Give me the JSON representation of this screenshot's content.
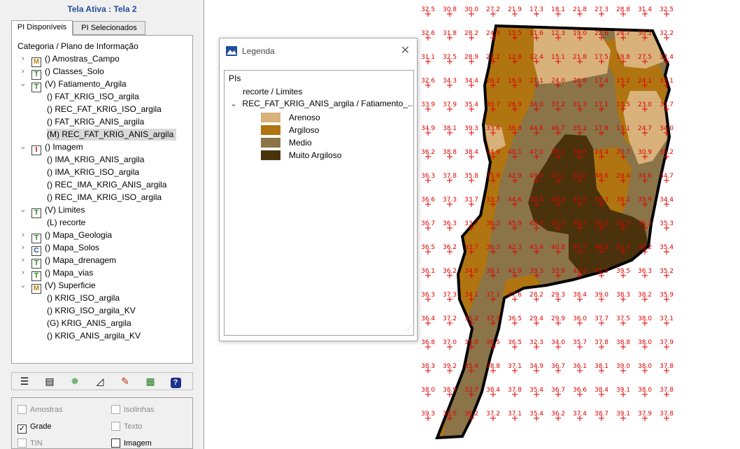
{
  "left_panel": {
    "title": "Tela Ativa : Tela 2",
    "tabs": [
      "PI Disponíveis",
      "PI Selecionados"
    ],
    "tree_header": "Categoria / Plano de Informação",
    "tree": [
      {
        "label": "() Amostras_Campo",
        "icon": "M",
        "expanded": false
      },
      {
        "label": "() Classes_Solo",
        "icon": "T",
        "expanded": false
      },
      {
        "label": "(V) Fatiamento_Argila",
        "icon": "T",
        "expanded": true
      },
      {
        "label": "() FAT_KRIG_ISO_argila",
        "child": true
      },
      {
        "label": "() REC_FAT_KRIG_ISO_argila",
        "child": true
      },
      {
        "label": "() FAT_KRIG_ANIS_argila",
        "child": true
      },
      {
        "label": "(M) REC_FAT_KRIG_ANIS_argila",
        "child": true,
        "selected": true
      },
      {
        "label": "() Imagem",
        "icon": "I",
        "expanded": true
      },
      {
        "label": "() IMA_KRIG_ANIS_argila",
        "child": true
      },
      {
        "label": "() IMA_KRIG_ISO_argila",
        "child": true
      },
      {
        "label": "() REC_IMA_KRIG_ANIS_argila",
        "child": true
      },
      {
        "label": "() REC_IMA_KRIG_ISO_argila",
        "child": true
      },
      {
        "label": "(V) Limites",
        "icon": "T",
        "expanded": true
      },
      {
        "label": "(L) recorte",
        "child": true
      },
      {
        "label": "() Mapa_Geologia",
        "icon": "T",
        "expanded": false
      },
      {
        "label": "() Mapa_Solos",
        "icon": "C",
        "expanded": false
      },
      {
        "label": "() Mapa_drenagem",
        "icon": "T",
        "expanded": false
      },
      {
        "label": "() Mapa_vias",
        "icon": "T",
        "expanded": false
      },
      {
        "label": "(V) Superficie",
        "icon": "M",
        "expanded": true
      },
      {
        "label": "() KRIG_ISO_argila",
        "child": true
      },
      {
        "label": "() KRIG_ISO_argila_KV",
        "child": true
      },
      {
        "label": "(G) KRIG_ANIS_argila",
        "child": true
      },
      {
        "label": "() KRIG_ANIS_argila_KV",
        "child": true
      }
    ],
    "toolbar_icons": [
      "list-icon",
      "properties-icon",
      "tools-icon",
      "chart-icon",
      "pencil-icon",
      "table-icon",
      "help-icon"
    ],
    "options": [
      {
        "label": "Amostras",
        "checked": false,
        "enabled": false
      },
      {
        "label": "Isolinhas",
        "checked": false,
        "enabled": false
      },
      {
        "label": "Grade",
        "checked": true,
        "enabled": true
      },
      {
        "label": "Texto",
        "checked": false,
        "enabled": false
      },
      {
        "label": "TIN",
        "checked": false,
        "enabled": false
      },
      {
        "label": "Imagem",
        "checked": false,
        "enabled": true
      }
    ]
  },
  "legend": {
    "title": "Legenda",
    "root_label": "PIs",
    "items": [
      "recorte / Limites",
      "REC_FAT_KRIG_ANIS_argila / Fatiamento_..."
    ],
    "classes": [
      {
        "label": "Arenoso",
        "color": "#d8b27a"
      },
      {
        "label": "Argiloso",
        "color": "#b07510"
      },
      {
        "label": "Medio",
        "color": "#8a7448"
      },
      {
        "label": "Muito Argiloso",
        "color": "#4a330c"
      }
    ]
  },
  "map": {
    "grid_values": [
      [
        "32.5",
        "30.8",
        "30.0",
        "27.2",
        "21.9",
        "17.3",
        "18.1",
        "21.8",
        "27.3",
        "28.8",
        "31.4",
        "32.5"
      ],
      [
        "32.6",
        "31.8",
        "28.2",
        "24.3",
        "15.5",
        "11.6",
        "12.3",
        "19.0",
        "22.6",
        "24.7",
        "30.1",
        "32.2"
      ],
      [
        "31.1",
        "32.5",
        "28.9",
        "22.2",
        "12.8",
        "12.4",
        "15.1",
        "21.8",
        "17.5",
        "19.8",
        "27.5",
        "32.4"
      ],
      [
        "32.6",
        "34.3",
        "34.4",
        "26.2",
        "16.9",
        "21.1",
        "24.0",
        "26.8",
        "17.4",
        "15.2",
        "24.1",
        "33.1"
      ],
      [
        "33.9",
        "37.9",
        "35.4",
        "30.7",
        "26.9",
        "34.0",
        "37.2",
        "31.3",
        "17.1",
        "13.5",
        "23.0",
        "32.7"
      ],
      [
        "34.9",
        "38.1",
        "39.3",
        "33.6",
        "36.8",
        "44.6",
        "46.7",
        "35.2",
        "17.9",
        "13.1",
        "24.7",
        "34.0"
      ],
      [
        "36.2",
        "38.8",
        "38.4",
        "34.9",
        "40.1",
        "47.0",
        "50.1",
        "36.0",
        "24.4",
        "20.7",
        "30.9",
        "35.2"
      ],
      [
        "36.3",
        "37.8",
        "35.8",
        "35.9",
        "42.9",
        "49.0",
        "47.1",
        "42.0",
        "38.6",
        "29.4",
        "34.6",
        "34.7"
      ],
      [
        "36.6",
        "37.3",
        "33.7",
        "33.7",
        "44.6",
        "50.4",
        "49.4",
        "47.4",
        "50.3",
        "38.2",
        "35.9",
        "34.4"
      ],
      [
        "36.7",
        "36.3",
        "33.7",
        "36.2",
        "45.9",
        "48.4",
        "47.5",
        "48.7",
        "50.0",
        "42.0",
        "36.3",
        "35.3"
      ],
      [
        "36.5",
        "36.2",
        "33.7",
        "36.3",
        "42.3",
        "43.4",
        "40.8",
        "47.7",
        "48.8",
        "41.3",
        "36.2",
        "35.4"
      ],
      [
        "36.1",
        "36.2",
        "34.0",
        "38.1",
        "42.9",
        "39.3",
        "33.9",
        "42.6",
        "42.5",
        "39.5",
        "36.3",
        "35.2"
      ],
      [
        "36.3",
        "37.3",
        "34.1",
        "37.1",
        "37.6",
        "28.2",
        "29.3",
        "38.4",
        "39.0",
        "38.3",
        "38.2",
        "35.9"
      ],
      [
        "36.4",
        "37.2",
        "35.2",
        "37.3",
        "36.5",
        "29.4",
        "29.9",
        "36.0",
        "37.7",
        "37.5",
        "38.0",
        "37.1"
      ],
      [
        "36.8",
        "37.0",
        "35.8",
        "36.5",
        "36.5",
        "32.3",
        "34.0",
        "35.7",
        "37.8",
        "38.8",
        "38.0",
        "37.9"
      ],
      [
        "38.3",
        "39.2",
        "35.4",
        "38.8",
        "37.1",
        "34.9",
        "36.7",
        "36.1",
        "38.1",
        "39.0",
        "38.0",
        "37.8"
      ],
      [
        "38.0",
        "38.9",
        "33.7",
        "38.4",
        "37.8",
        "35.4",
        "36.7",
        "36.6",
        "38.4",
        "39.1",
        "38.0",
        "37.8"
      ],
      [
        "39.3",
        "38.0",
        "36.2",
        "37.2",
        "37.1",
        "35.4",
        "36.2",
        "37.4",
        "38.7",
        "39.1",
        "37.9",
        "37.8"
      ]
    ]
  }
}
